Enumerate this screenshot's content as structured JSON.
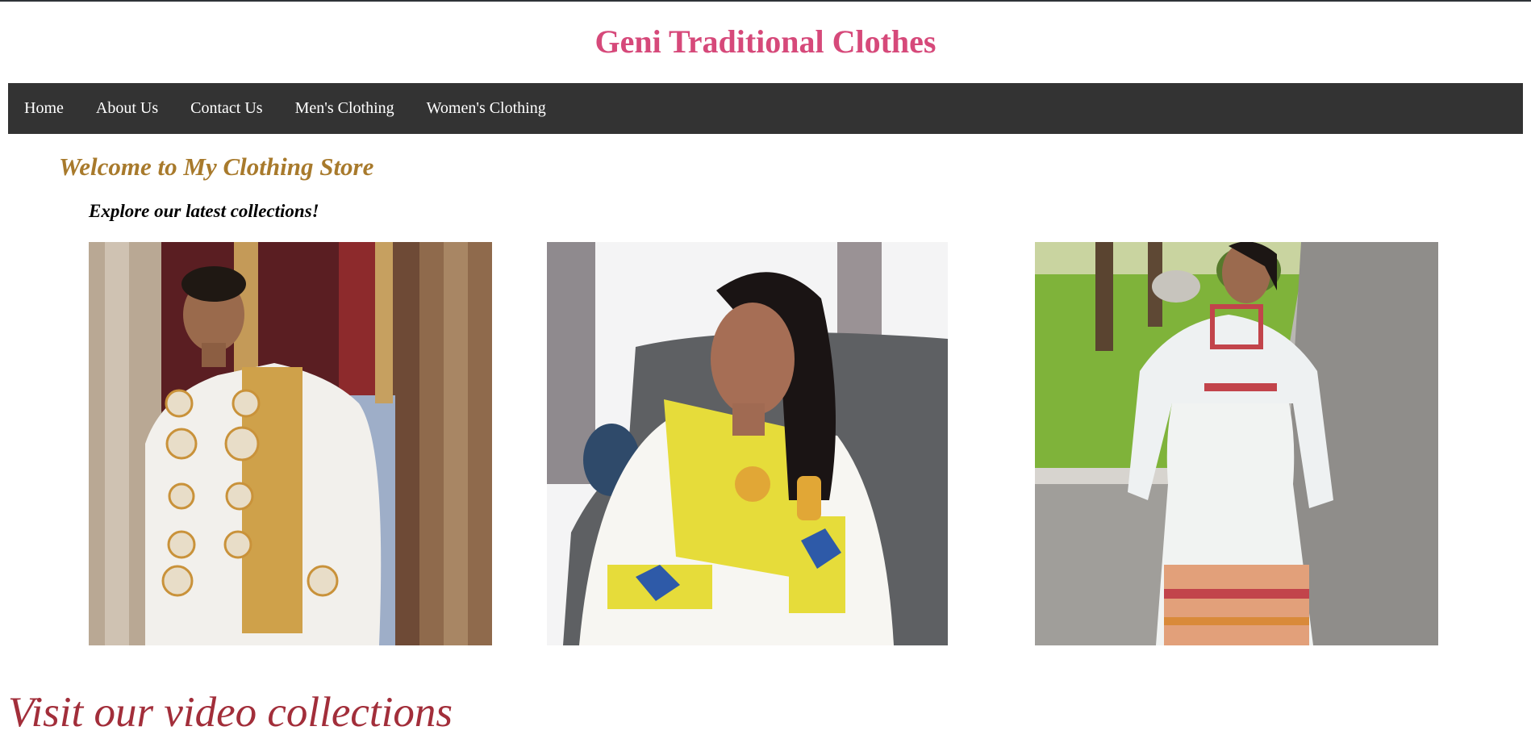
{
  "header": {
    "title": "Geni Traditional Clothes"
  },
  "nav": {
    "items": [
      {
        "label": "Home"
      },
      {
        "label": "About Us"
      },
      {
        "label": "Contact Us"
      },
      {
        "label": "Men's Clothing"
      },
      {
        "label": "Women's Clothing"
      }
    ]
  },
  "main": {
    "welcome": "Welcome to My Clothing Store",
    "explore": "Explore our latest collections!",
    "video_heading": "Visit our video collections"
  },
  "colors": {
    "title": "#d6497a",
    "nav_bg": "#333333",
    "welcome": "#a87a2c",
    "video_heading": "#a22e3a"
  }
}
